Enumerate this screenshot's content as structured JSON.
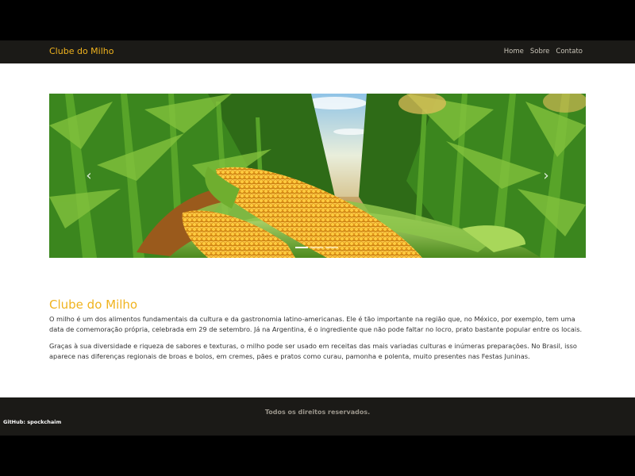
{
  "navbar": {
    "brand": "Clube do Milho",
    "links": [
      "Home",
      "Sobre",
      "Contato"
    ]
  },
  "carousel": {
    "prev_symbol": "‹",
    "next_symbol": "›",
    "slide_count": 3,
    "active_index": 0
  },
  "content": {
    "title": "Clube do Milho",
    "paragraphs": [
      "O milho é um dos alimentos fundamentais da cultura e da gastronomia latino-americanas. Ele é tão importante na região que, no México, por exemplo, tem uma data de comemoração própria, celebrada em 29 de setembro. Já na Argentina, é o ingrediente que não pode faltar no locro, prato bastante popular entre os locais.",
      "Graças à sua diversidade e riqueza de sabores e texturas, o milho pode ser usado em receitas das mais variadas culturas e inúmeras preparações. No Brasil, isso aparece nas diferenças regionais de broas e bolos, em cremes, pães e pratos como curau, pamonha e polenta, muito presentes nas Festas Juninas."
    ]
  },
  "footer": {
    "rights": "Todos os direitos reservados.",
    "github": "GitHub: spockchaim"
  },
  "colors": {
    "brand_yellow": "#f0b31e",
    "dark_bar": "#1b1a17"
  }
}
